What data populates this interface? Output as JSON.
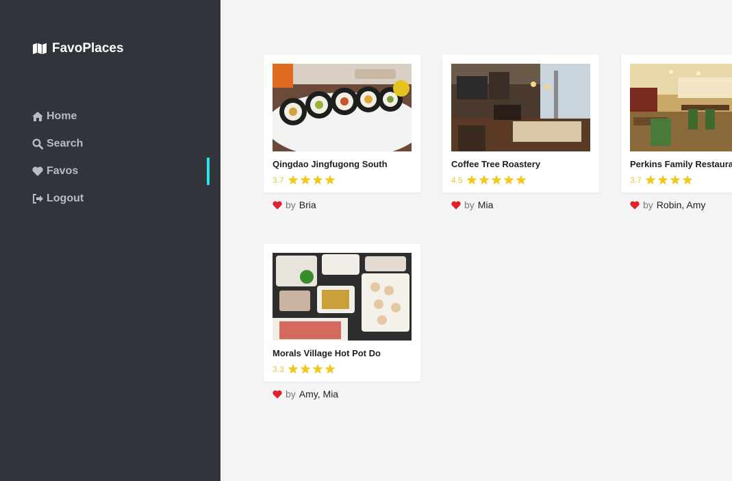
{
  "app": {
    "name": "FavoPlaces"
  },
  "nav": [
    {
      "label": "Home",
      "icon": "home-icon"
    },
    {
      "label": "Search",
      "icon": "search-icon"
    },
    {
      "label": "Favos",
      "icon": "heart-icon",
      "active": true
    },
    {
      "label": "Logout",
      "icon": "logout-icon"
    }
  ],
  "colors": {
    "sidebar": "#31343b",
    "accent": "#29e3f0",
    "star": "#f2c81e",
    "heart": "#e2202a"
  },
  "places": [
    {
      "name": "Qingdao Jingfugong South",
      "rating": "3.7",
      "stars": 4,
      "by_label": "by",
      "favorited_by": "Bria"
    },
    {
      "name": "Coffee Tree Roastery",
      "rating": "4.5",
      "stars": 5,
      "by_label": "by",
      "favorited_by": "Mia"
    },
    {
      "name": "Perkins Family Restaurant",
      "rating": "3.7",
      "stars": 4,
      "by_label": "by",
      "favorited_by": "Robin, Amy"
    },
    {
      "name": "Morals Village Hot Pot Do",
      "rating": "3.3",
      "stars": 4,
      "by_label": "by",
      "favorited_by": "Amy, Mia"
    }
  ]
}
